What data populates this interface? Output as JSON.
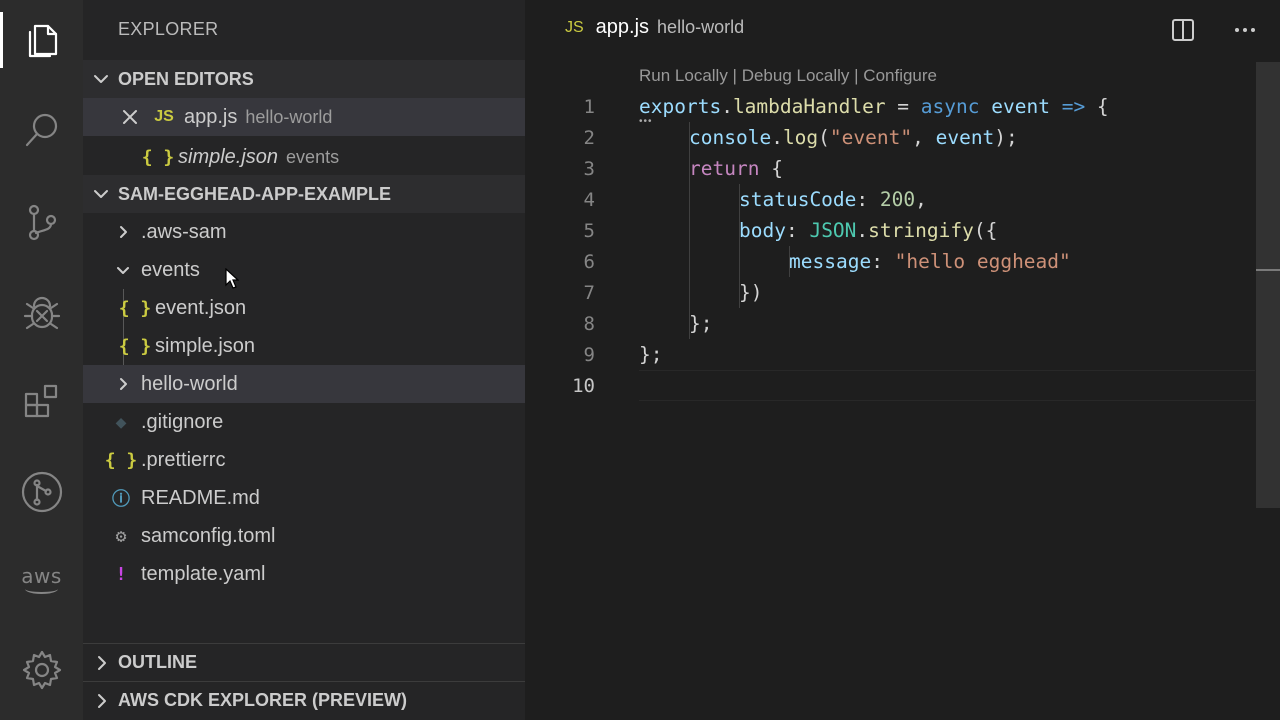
{
  "activity_bar": {
    "icons": [
      "files-icon",
      "search-icon",
      "source-control-icon",
      "debug-icon",
      "extensions-icon",
      "gitlens-icon",
      "aws-icon",
      "settings-gear-icon"
    ],
    "aws_label": "aws"
  },
  "sidebar": {
    "title": "EXPLORER",
    "open_editors": {
      "header": "OPEN EDITORS",
      "items": [
        {
          "icon": "JS",
          "name": "app.js",
          "desc": "hello-world"
        },
        {
          "icon": "{ }",
          "name": "simple.json",
          "desc": "events"
        }
      ]
    },
    "project": {
      "header": "SAM-EGGHEAD-APP-EXAMPLE",
      "items": [
        {
          "name": ".aws-sam"
        },
        {
          "name": "events"
        },
        {
          "icon": "{ }",
          "name": "event.json"
        },
        {
          "icon": "{ }",
          "name": "simple.json"
        },
        {
          "name": "hello-world"
        },
        {
          "icon": "git",
          "name": ".gitignore"
        },
        {
          "icon": "{ }",
          "name": ".prettierrc"
        },
        {
          "icon": "i",
          "name": "README.md"
        },
        {
          "icon": "gear",
          "name": "samconfig.toml"
        },
        {
          "icon": "!",
          "name": "template.yaml"
        }
      ]
    },
    "outline_header": "OUTLINE",
    "cdk_header": "AWS CDK EXPLORER (PREVIEW)"
  },
  "editor": {
    "tab": {
      "icon": "JS",
      "name": "app.js",
      "desc": "hello-world"
    },
    "codelens": "Run Locally | Debug Locally | Configure",
    "line_numbers": [
      "1",
      "2",
      "3",
      "4",
      "5",
      "6",
      "7",
      "8",
      "9",
      "10"
    ],
    "code": {
      "l1": {
        "a": "exports",
        "b": ".",
        "c": "lambdaHandler",
        "d": " = ",
        "e": "async",
        "f": " ",
        "g": "event",
        "h": " ",
        "i": "=>",
        "j": " {"
      },
      "l2": {
        "a": "console",
        "b": ".",
        "c": "log",
        "d": "(",
        "e": "\"event\"",
        "f": ", ",
        "g": "event",
        "h": ");"
      },
      "l3": {
        "a": "return",
        "b": " {"
      },
      "l4": {
        "a": "statusCode",
        "b": ": ",
        "c": "200",
        "d": ","
      },
      "l5": {
        "a": "body",
        "b": ": ",
        "c": "JSON",
        "d": ".",
        "e": "stringify",
        "f": "({"
      },
      "l6": {
        "a": "message",
        "b": ": ",
        "c": "\"hello egghead\""
      },
      "l7": {
        "a": "})"
      },
      "l8": {
        "a": "};"
      },
      "l9": {
        "a": "};"
      }
    }
  }
}
